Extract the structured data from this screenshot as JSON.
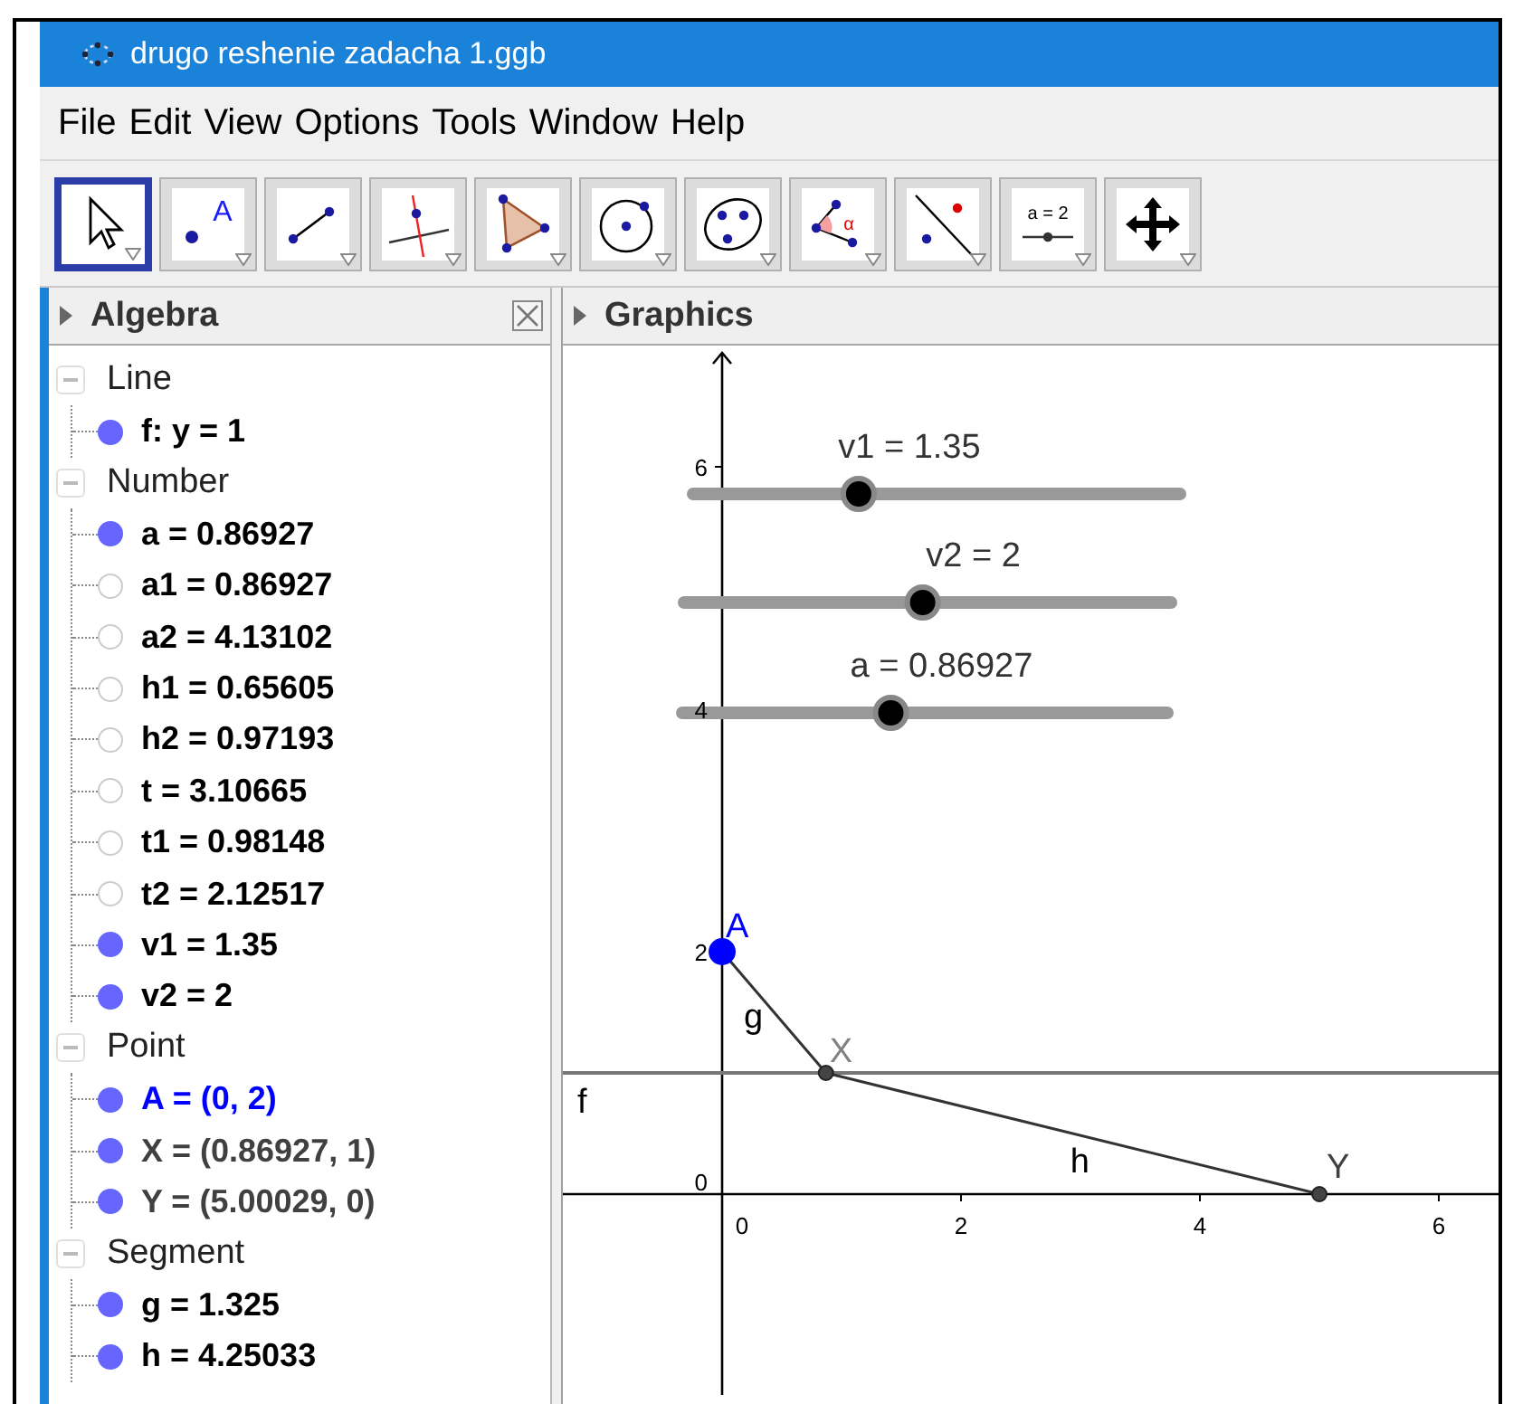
{
  "window": {
    "title": "drugo reshenie zadacha 1.ggb"
  },
  "menu": [
    "File",
    "Edit",
    "View",
    "Options",
    "Tools",
    "Window",
    "Help"
  ],
  "toolbar": [
    {
      "kind": "move",
      "selected": true
    },
    {
      "kind": "point",
      "selected": false,
      "label": "A"
    },
    {
      "kind": "segment",
      "selected": false
    },
    {
      "kind": "perpendicular",
      "selected": false
    },
    {
      "kind": "polygon",
      "selected": false
    },
    {
      "kind": "circle",
      "selected": false
    },
    {
      "kind": "conic",
      "selected": false
    },
    {
      "kind": "angle",
      "selected": false,
      "label": "α"
    },
    {
      "kind": "reflect",
      "selected": false
    },
    {
      "kind": "slider",
      "selected": false,
      "label": "a = 2"
    },
    {
      "kind": "move_view",
      "selected": false
    }
  ],
  "algebra": {
    "title": "Algebra",
    "groups": [
      {
        "label": "Line",
        "expanded": true,
        "children": [
          {
            "text": "f: y = 1",
            "visible": true,
            "color": "#000000"
          }
        ]
      },
      {
        "label": "Number",
        "expanded": true,
        "children": [
          {
            "text": "a = 0.86927",
            "visible": true,
            "color": "#000000"
          },
          {
            "text": "a1 = 0.86927",
            "visible": false,
            "color": "#000000"
          },
          {
            "text": "a2 = 4.13102",
            "visible": false,
            "color": "#000000"
          },
          {
            "text": "h1 = 0.65605",
            "visible": false,
            "color": "#000000"
          },
          {
            "text": "h2 = 0.97193",
            "visible": false,
            "color": "#000000"
          },
          {
            "text": "t = 3.10665",
            "visible": false,
            "color": "#000000"
          },
          {
            "text": "t1 = 0.98148",
            "visible": false,
            "color": "#000000"
          },
          {
            "text": "t2 = 2.12517",
            "visible": false,
            "color": "#000000"
          },
          {
            "text": "v1 = 1.35",
            "visible": true,
            "color": "#000000"
          },
          {
            "text": "v2 = 2",
            "visible": true,
            "color": "#000000"
          }
        ]
      },
      {
        "label": "Point",
        "expanded": true,
        "children": [
          {
            "text": "A = (0, 2)",
            "visible": true,
            "color": "#0000ff"
          },
          {
            "text": "X = (0.86927, 1)",
            "visible": true,
            "color": "#404040"
          },
          {
            "text": "Y = (5.00029, 0)",
            "visible": true,
            "color": "#404040"
          }
        ]
      },
      {
        "label": "Segment",
        "expanded": true,
        "children": [
          {
            "text": "g = 1.325",
            "visible": true,
            "color": "#000000"
          },
          {
            "text": "h = 4.25033",
            "visible": true,
            "color": "#000000"
          }
        ]
      }
    ]
  },
  "graphics": {
    "title": "Graphics",
    "sliders": [
      {
        "label": "v1 = 1.35",
        "level": 0.34
      },
      {
        "label": "v2 = 2",
        "level": 0.49
      },
      {
        "label": "a = 0.86927",
        "level": 0.43
      }
    ],
    "x_tick_labels": [
      "0",
      "2",
      "4",
      "6"
    ],
    "y_tick_labels": [
      "6",
      "4",
      "2",
      "0"
    ],
    "line": {
      "label": "f"
    },
    "points": [
      {
        "label": "A",
        "color": "#0000ff"
      },
      {
        "label": "X",
        "color": "#808080"
      },
      {
        "label": "Y",
        "color": "#404040"
      }
    ],
    "segments": [
      {
        "label": "g"
      },
      {
        "label": "h"
      }
    ]
  }
}
